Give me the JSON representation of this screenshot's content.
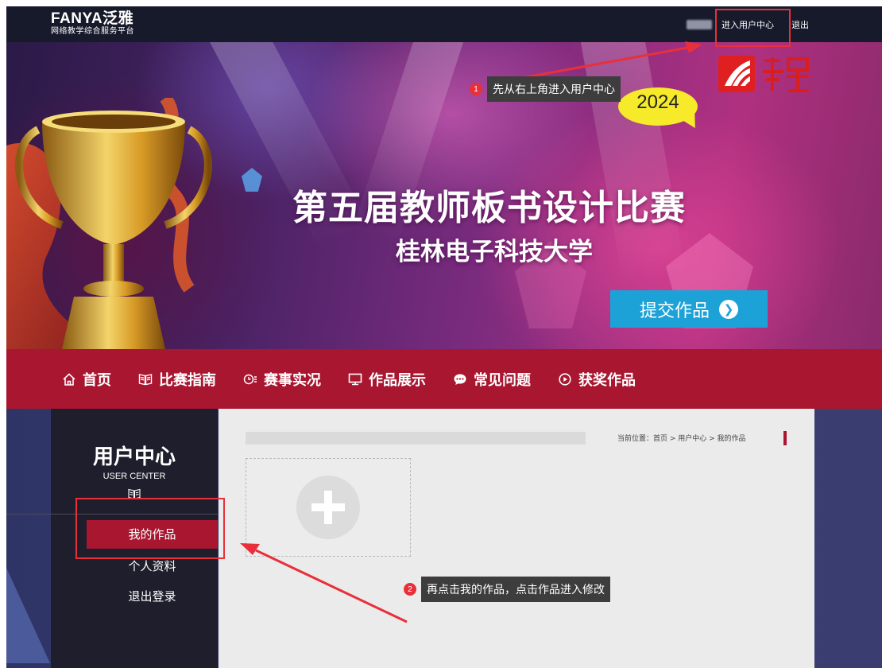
{
  "topbar": {
    "logo_main": "FANYA泛雅",
    "logo_sub": "网络教学综合服务平台",
    "user_center_link": "进入用户中心",
    "exit_link": "退出"
  },
  "banner": {
    "badge_year": "2024",
    "title": "第五届教师板书设计比赛",
    "subtitle": "桂林电子科技大学",
    "submit_button": "提交作品"
  },
  "nav": {
    "items": [
      {
        "label": "首页",
        "icon": "home-icon"
      },
      {
        "label": "比赛指南",
        "icon": "book-icon"
      },
      {
        "label": "赛事实况",
        "icon": "live-icon"
      },
      {
        "label": "作品展示",
        "icon": "monitor-icon"
      },
      {
        "label": "常见问题",
        "icon": "chat-icon"
      },
      {
        "label": "获奖作品",
        "icon": "play-circle-icon"
      }
    ]
  },
  "sidebar": {
    "title": "用户中心",
    "subtitle": "USER CENTER",
    "items": [
      {
        "label": "我的作品",
        "active": true
      },
      {
        "label": "个人资料",
        "active": false
      },
      {
        "label": "退出登录",
        "active": false
      }
    ]
  },
  "main": {
    "breadcrumb": "当前位置：首页 > 用户中心 > 我的作品"
  },
  "annotations": {
    "step1_num": "1",
    "step1_text": "先从右上角进入用户中心",
    "step2_num": "2",
    "step2_text": "再点击我的作品，点击作品进入修改"
  },
  "colors": {
    "topbar_bg": "#171a2b",
    "nav_bg": "#a81630",
    "submit_bg": "#1da2d8",
    "annotation_red": "#e8303a"
  }
}
